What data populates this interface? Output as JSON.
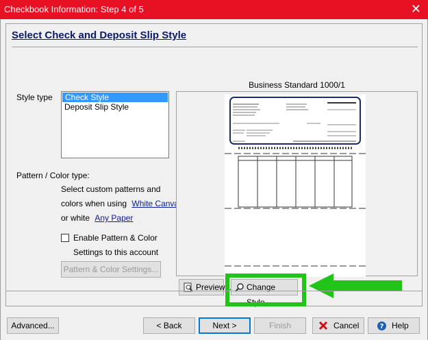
{
  "window": {
    "title": "Checkbook Information: Step 4 of 5",
    "close_glyph": "✕"
  },
  "heading": "Select Check and Deposit Slip Style",
  "style_type": {
    "label": "Style type",
    "items": [
      "Check Style",
      "Deposit Slip Style"
    ],
    "selected_index": 0
  },
  "pattern": {
    "label": "Pattern / Color type:",
    "desc_line1": "Select custom patterns and",
    "desc_line2_prefix": "colors when using",
    "white_canvas_link": "White Canvas",
    "desc_line3_prefix": "or white",
    "any_paper_link": "Any Paper",
    "enable_label": "Enable Pattern & Color",
    "enable_label_line2": "Settings to this account",
    "enable_checked": false,
    "settings_button": "Pattern & Color Settings..."
  },
  "preview": {
    "title": "Business Standard 1000/1",
    "preview_button": "Preview...",
    "change_style_button": "Change Style..."
  },
  "footer": {
    "advanced": "Advanced...",
    "back": "< Back",
    "next": "Next >",
    "finish": "Finish",
    "cancel": "Cancel",
    "help": "Help"
  },
  "colors": {
    "titlebar": "#e81123",
    "highlight_box": "#22c41a",
    "arrow": "#22c41a",
    "selection": "#3399ff",
    "link": "#0a1a9b"
  }
}
